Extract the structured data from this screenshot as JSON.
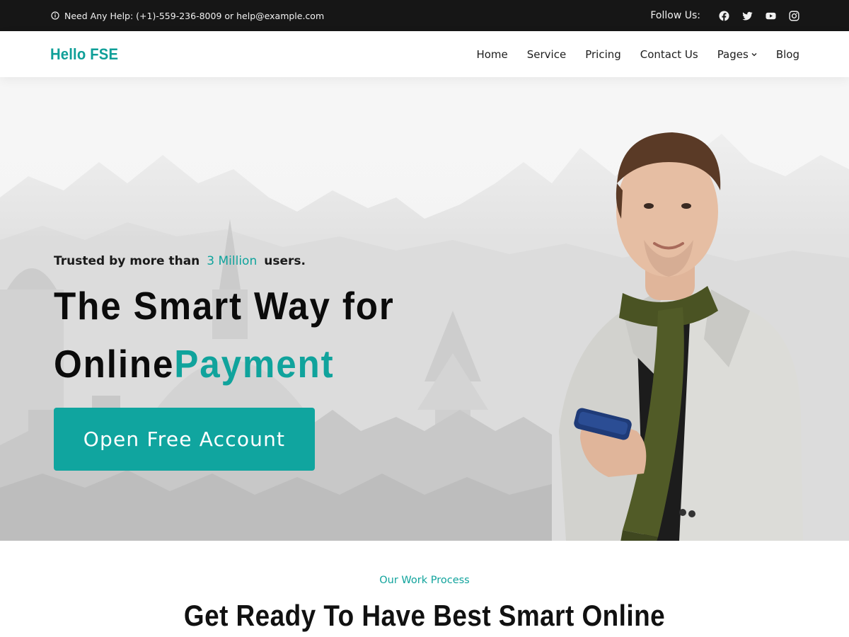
{
  "topbar": {
    "help_text": "Need Any Help: (+1)-559-236-8009 or help@example.com",
    "follow_label": "Follow Us:",
    "social_icons": [
      "facebook-icon",
      "twitter-icon",
      "youtube-icon",
      "instagram-icon"
    ]
  },
  "header": {
    "logo": "Hello FSE",
    "nav": [
      {
        "label": "Home"
      },
      {
        "label": "Service"
      },
      {
        "label": "Pricing"
      },
      {
        "label": "Contact Us"
      },
      {
        "label": "Pages",
        "has_dropdown": true
      },
      {
        "label": "Blog"
      }
    ]
  },
  "hero": {
    "trusted_prefix": "Trusted by more than",
    "trusted_highlight": "3 Million",
    "trusted_suffix": "users.",
    "headline_line1": "The Smart Way for",
    "headline_line2_plain": "Online",
    "headline_line2_accent": "Payment",
    "cta_label": "Open Free Account"
  },
  "process": {
    "label": "Our Work Process",
    "title": "Get Ready To Have Best Smart Online"
  },
  "colors": {
    "accent": "#10a39c",
    "topbar_bg": "#161616",
    "cta_bg": "#10a59f"
  }
}
